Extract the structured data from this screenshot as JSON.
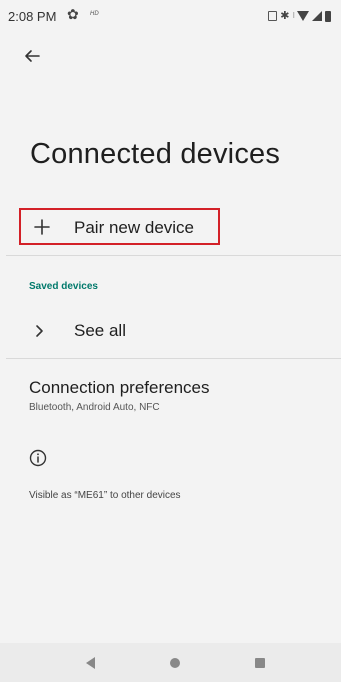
{
  "status_bar": {
    "time": "2:08 PM",
    "hd_label": "HD",
    "icons": [
      "settings-gear-icon",
      "vibrate-icon",
      "bluetooth-icon",
      "volume-icon",
      "wifi-icon",
      "signal-icon",
      "battery-icon"
    ]
  },
  "header": {
    "back_icon": "arrow-back-icon",
    "title": "Connected devices"
  },
  "pair_row": {
    "icon": "plus-icon",
    "label": "Pair new device",
    "highlight_color": "#d32027"
  },
  "saved_devices": {
    "header": "Saved devices",
    "header_color": "#00796b",
    "see_all": {
      "icon": "chevron-right-icon",
      "label": "See all"
    }
  },
  "connection_preferences": {
    "title": "Connection preferences",
    "subtitle": "Bluetooth, Android Auto, NFC"
  },
  "footer": {
    "icon": "info-icon",
    "visible_as": "Visible as “ME61” to other devices"
  },
  "nav_bar": {
    "icons": [
      "nav-back-icon",
      "nav-home-icon",
      "nav-recents-icon"
    ]
  }
}
